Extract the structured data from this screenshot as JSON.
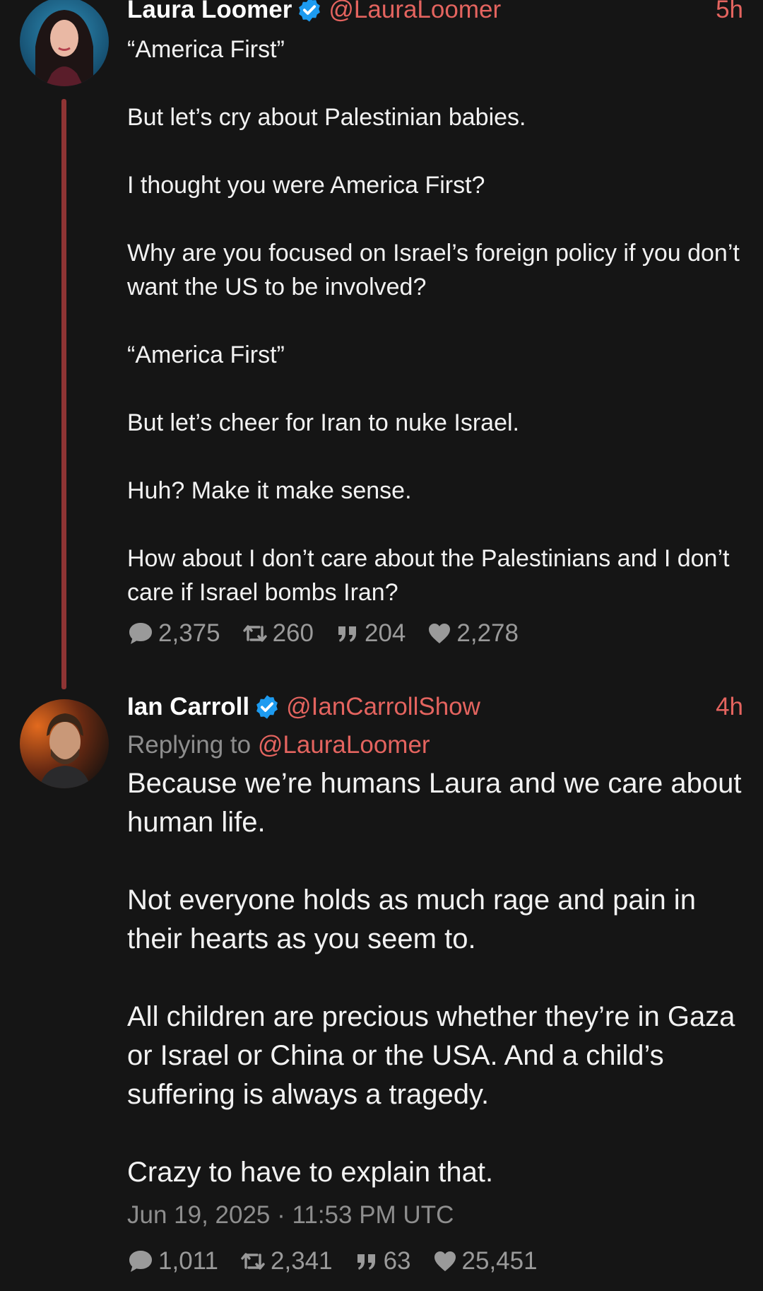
{
  "tweets": [
    {
      "author": {
        "name": "Laura Loomer",
        "handle": "@LauraLoomer",
        "verified": true,
        "avatar_icon": "profile-photo-woman"
      },
      "time": "5h",
      "text": "“America First”\n\nBut let’s cry about Palestinian babies.\n\nI thought you were America First?\n\nWhy are you focused on Israel’s foreign policy if you don’t want the US to be involved?\n\n“America First”\n\nBut let’s cheer for Iran to nuke Israel.\n\nHuh? Make it make sense.\n\nHow about I don’t care about the Palestinians and I don’t care if Israel bombs Iran?",
      "stats": {
        "replies": "2,375",
        "retweets": "260",
        "quotes": "204",
        "likes": "2,278"
      }
    },
    {
      "author": {
        "name": "Ian Carroll",
        "handle": "@IanCarrollShow",
        "verified": true,
        "avatar_icon": "profile-photo-man"
      },
      "time": "4h",
      "replying_label": "Replying to",
      "replying_to": "@LauraLoomer",
      "text": "Because we’re humans Laura and we care about human life.\n\nNot everyone holds as much rage and pain in their hearts as you seem to.\n\nAll children are precious whether they’re in Gaza or Israel or China or the USA. And a child’s suffering is always a tragedy.\n\nCrazy to have to explain that.",
      "date": "Jun 19, 2025 · 11:53 PM UTC",
      "stats": {
        "replies": "1,011",
        "retweets": "2,341",
        "quotes": "63",
        "likes": "25,451"
      }
    }
  ],
  "colors": {
    "background": "#151515",
    "accent": "#e4645f",
    "thread_line": "#8f3434",
    "verified": "#1d9bf0",
    "muted": "#8e8e8e"
  },
  "icons": {
    "reply": "comment-icon",
    "retweet": "retweet-icon",
    "quote": "quote-icon",
    "like": "heart-icon",
    "verified": "verified-badge-icon"
  }
}
